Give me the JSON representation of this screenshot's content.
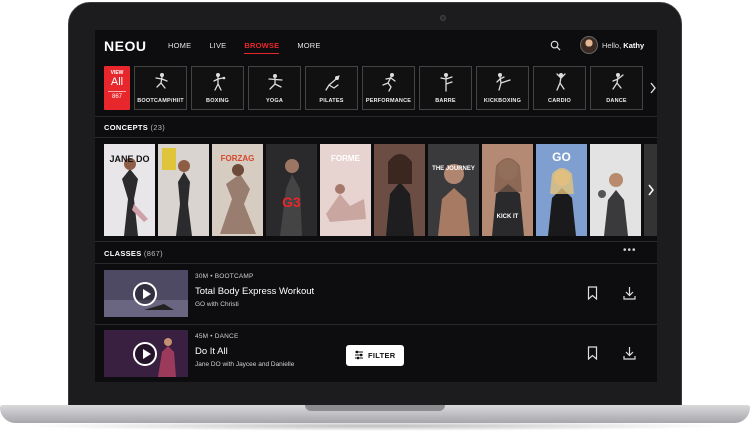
{
  "app": {
    "logo": "NEOU",
    "nav": [
      "HOME",
      "LIVE",
      "BROWSE",
      "MORE"
    ],
    "active_nav": "BROWSE",
    "greeting": "Hello,",
    "user_name": "Kathy"
  },
  "categories": {
    "view_all": {
      "top": "VIEW",
      "main": "All",
      "count": "867"
    },
    "items": [
      {
        "label": "BOOTCAMP/HIIT",
        "icon": "bootcamp-icon"
      },
      {
        "label": "BOXING",
        "icon": "boxing-icon"
      },
      {
        "label": "YOGA",
        "icon": "yoga-icon"
      },
      {
        "label": "PILATES",
        "icon": "pilates-icon"
      },
      {
        "label": "PERFORMANCE",
        "icon": "performance-icon"
      },
      {
        "label": "BARRE",
        "icon": "barre-icon"
      },
      {
        "label": "KICKBOXING",
        "icon": "kickboxing-icon"
      },
      {
        "label": "CARDIO",
        "icon": "cardio-icon"
      },
      {
        "label": "DANCE",
        "icon": "dance-icon"
      }
    ]
  },
  "concepts": {
    "title": "CONCEPTS",
    "count": "(23)",
    "posters": [
      {
        "text": "JANE DO",
        "bg": "#e9e6e9",
        "fg": "#111"
      },
      {
        "text": "",
        "bg": "#d9d4cf",
        "fg": "#111"
      },
      {
        "text": "FORZAG",
        "bg": "#d6ccc2",
        "fg": "#d6472b"
      },
      {
        "text": "G3",
        "bg": "#2a2a2c",
        "fg": "#e8272c"
      },
      {
        "text": "FORME",
        "bg": "#e7d3cf",
        "fg": "#fff"
      },
      {
        "text": "",
        "bg": "#6b4d44",
        "fg": "#fff"
      },
      {
        "text": "THE JOURNEY",
        "bg": "#3a3a3c",
        "fg": "#fff"
      },
      {
        "text": "KICK IT",
        "bg": "#b48a74",
        "fg": "#fff"
      },
      {
        "text": "GO",
        "bg": "#7f9fd0",
        "fg": "#fff"
      },
      {
        "text": "",
        "bg": "#e3e3e3",
        "fg": "#111"
      }
    ]
  },
  "classes": {
    "title": "CLASSES",
    "count": "(867)",
    "items": [
      {
        "meta": "30M • BOOTCAMP",
        "title": "Total Body Express Workout",
        "instructor": "GO with Christi",
        "thumb_bg": "#4e4a63"
      },
      {
        "meta": "45M • DANCE",
        "title": "Do It All",
        "instructor": "Jane DO with Jaycee and Danielle",
        "thumb_bg": "#5a2f55"
      }
    ]
  },
  "filter_label": "FILTER",
  "colors": {
    "accent": "#e8272c",
    "screen_bg": "#0d0d0f"
  }
}
